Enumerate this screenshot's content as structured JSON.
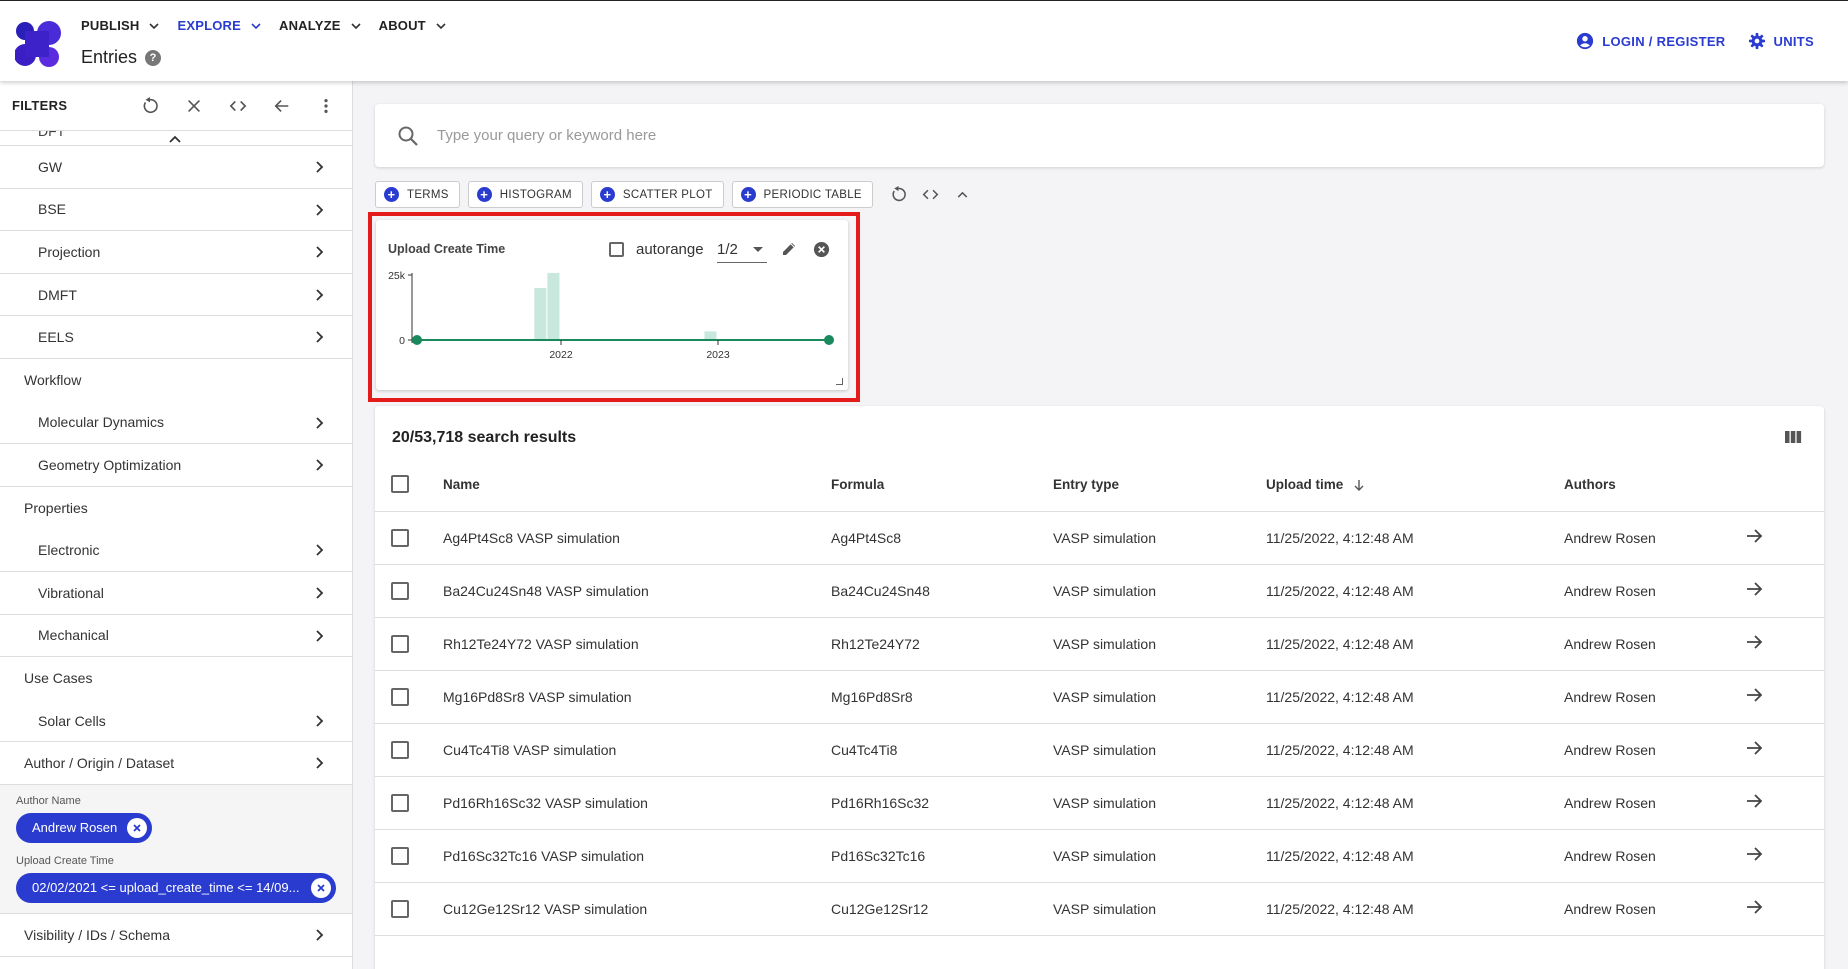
{
  "header": {
    "nav": [
      {
        "label": "PUBLISH",
        "active": false
      },
      {
        "label": "EXPLORE",
        "active": true
      },
      {
        "label": "ANALYZE",
        "active": false
      },
      {
        "label": "ABOUT",
        "active": false
      }
    ],
    "page_title": "Entries",
    "help_glyph": "?",
    "login_label": "LOGIN / REGISTER",
    "units_label": "UNITS",
    "accent_color": "#2a3cd0"
  },
  "sidebar": {
    "title": "FILTERS",
    "clipped_item": "DFT",
    "items": [
      {
        "label": "GW",
        "type": "sub"
      },
      {
        "label": "BSE",
        "type": "sub"
      },
      {
        "label": "Projection",
        "type": "sub"
      },
      {
        "label": "DMFT",
        "type": "sub"
      },
      {
        "label": "EELS",
        "type": "sub"
      },
      {
        "label": "Workflow",
        "type": "section"
      },
      {
        "label": "Molecular Dynamics",
        "type": "sub"
      },
      {
        "label": "Geometry Optimization",
        "type": "sub"
      },
      {
        "label": "Properties",
        "type": "section"
      },
      {
        "label": "Electronic",
        "type": "sub"
      },
      {
        "label": "Vibrational",
        "type": "sub"
      },
      {
        "label": "Mechanical",
        "type": "sub"
      },
      {
        "label": "Use Cases",
        "type": "section"
      },
      {
        "label": "Solar Cells",
        "type": "sub"
      },
      {
        "label": "Author / Origin / Dataset",
        "type": "section-chev"
      }
    ],
    "active_filters": {
      "author_label": "Author Name",
      "author_value": "Andrew Rosen",
      "time_label": "Upload Create Time",
      "time_value": "02/02/2021 <= upload_create_time <= 14/09..."
    },
    "bottom_item": "Visibility / IDs / Schema"
  },
  "search": {
    "placeholder": "Type your query or keyword here"
  },
  "toolbar": {
    "buttons": [
      "TERMS",
      "HISTOGRAM",
      "SCATTER PLOT",
      "PERIODIC TABLE"
    ]
  },
  "widget": {
    "title": "Upload Create Time",
    "autorange_label": "autorange",
    "autorange_checked": false,
    "scale_value": "1/2"
  },
  "chart_data": {
    "type": "bar",
    "title": "Upload Create Time",
    "x_tick_labels": [
      "2022",
      "2023"
    ],
    "y_tick_labels": [
      "25k",
      "0"
    ],
    "ylim": [
      0,
      25000
    ],
    "bars": [
      {
        "x": "2021-11",
        "value": 20000
      },
      {
        "x": "2021-12",
        "value": 25800
      },
      {
        "x": "2022-12",
        "value": 3300
      }
    ],
    "bar_color": "#c9e8dd",
    "range_slider_color": "#1a8a5e"
  },
  "results": {
    "count_text": "20/53,718 search results",
    "columns": [
      "Name",
      "Formula",
      "Entry type",
      "Upload time",
      "Authors"
    ],
    "rows": [
      {
        "name": "Ag4Pt4Sc8 VASP simulation",
        "formula": "Ag4Pt4Sc8",
        "type": "VASP simulation",
        "time": "11/25/2022, 4:12:48 AM",
        "author": "Andrew Rosen"
      },
      {
        "name": "Ba24Cu24Sn48 VASP simulation",
        "formula": "Ba24Cu24Sn48",
        "type": "VASP simulation",
        "time": "11/25/2022, 4:12:48 AM",
        "author": "Andrew Rosen"
      },
      {
        "name": "Rh12Te24Y72 VASP simulation",
        "formula": "Rh12Te24Y72",
        "type": "VASP simulation",
        "time": "11/25/2022, 4:12:48 AM",
        "author": "Andrew Rosen"
      },
      {
        "name": "Mg16Pd8Sr8 VASP simulation",
        "formula": "Mg16Pd8Sr8",
        "type": "VASP simulation",
        "time": "11/25/2022, 4:12:48 AM",
        "author": "Andrew Rosen"
      },
      {
        "name": "Cu4Tc4Ti8 VASP simulation",
        "formula": "Cu4Tc4Ti8",
        "type": "VASP simulation",
        "time": "11/25/2022, 4:12:48 AM",
        "author": "Andrew Rosen"
      },
      {
        "name": "Pd16Rh16Sc32 VASP simulation",
        "formula": "Pd16Rh16Sc32",
        "type": "VASP simulation",
        "time": "11/25/2022, 4:12:48 AM",
        "author": "Andrew Rosen"
      },
      {
        "name": "Pd16Sc32Tc16 VASP simulation",
        "formula": "Pd16Sc32Tc16",
        "type": "VASP simulation",
        "time": "11/25/2022, 4:12:48 AM",
        "author": "Andrew Rosen"
      },
      {
        "name": "Cu12Ge12Sr12 VASP simulation",
        "formula": "Cu12Ge12Sr12",
        "type": "VASP simulation",
        "time": "11/25/2022, 4:12:48 AM",
        "author": "Andrew Rosen"
      }
    ]
  }
}
